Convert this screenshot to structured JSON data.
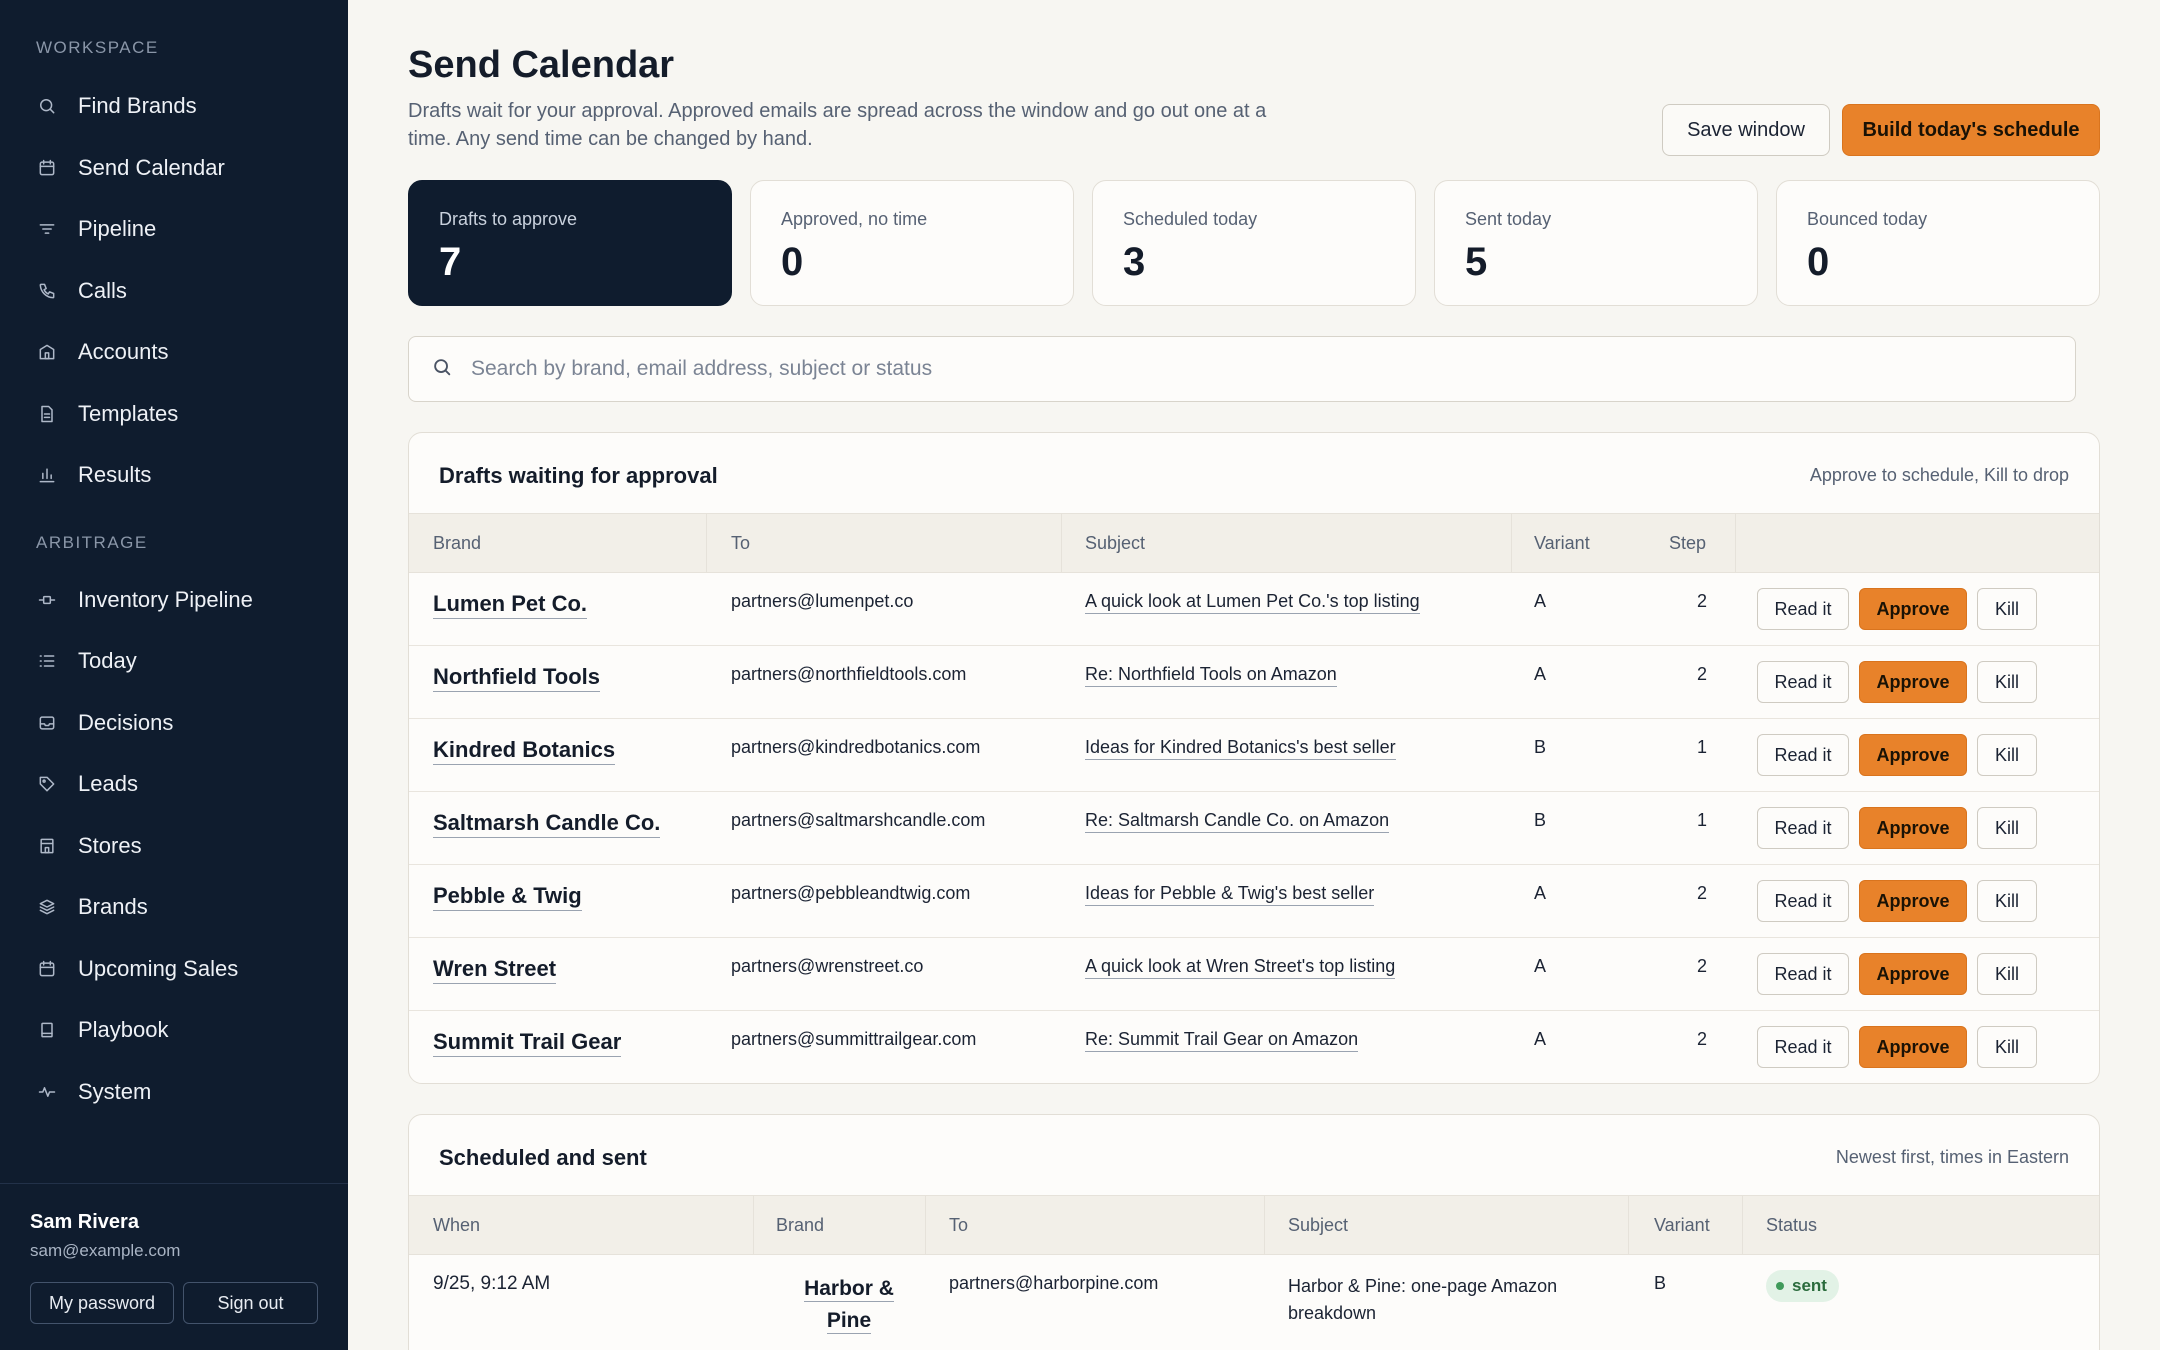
{
  "sidebar": {
    "workspace_label": "WORKSPACE",
    "workspace_items": [
      {
        "label": "Find Brands",
        "icon": "search-icon"
      },
      {
        "label": "Send Calendar",
        "icon": "calendar-icon"
      },
      {
        "label": "Pipeline",
        "icon": "filter-icon"
      },
      {
        "label": "Calls",
        "icon": "phone-icon"
      },
      {
        "label": "Accounts",
        "icon": "building-icon"
      },
      {
        "label": "Templates",
        "icon": "document-icon"
      },
      {
        "label": "Results",
        "icon": "bar-chart-icon"
      }
    ],
    "arbitrage_label": "ARBITRAGE",
    "arbitrage_items": [
      {
        "label": "Inventory Pipeline",
        "icon": "pipeline-icon"
      },
      {
        "label": "Today",
        "icon": "list-icon"
      },
      {
        "label": "Decisions",
        "icon": "inbox-icon"
      },
      {
        "label": "Leads",
        "icon": "tag-icon"
      },
      {
        "label": "Stores",
        "icon": "store-icon"
      },
      {
        "label": "Brands",
        "icon": "layers-icon"
      },
      {
        "label": "Upcoming Sales",
        "icon": "calendar-icon"
      },
      {
        "label": "Playbook",
        "icon": "book-icon"
      },
      {
        "label": "System",
        "icon": "activity-icon"
      }
    ],
    "user": {
      "name": "Sam Rivera",
      "email": "sam@example.com"
    },
    "my_password_label": "My password",
    "sign_out_label": "Sign out"
  },
  "header": {
    "title": "Send Calendar",
    "description": "Drafts wait for your approval. Approved emails are spread across the window and go out one at a time. Any send time can be changed by hand.",
    "save_window_label": "Save window",
    "build_schedule_label": "Build today's schedule"
  },
  "stats": [
    {
      "label": "Drafts to approve",
      "value": "7"
    },
    {
      "label": "Approved, no time",
      "value": "0"
    },
    {
      "label": "Scheduled today",
      "value": "3"
    },
    {
      "label": "Sent today",
      "value": "5"
    },
    {
      "label": "Bounced today",
      "value": "0"
    }
  ],
  "search": {
    "placeholder": "Search by brand, email address, subject or status"
  },
  "drafts": {
    "title": "Drafts waiting for approval",
    "note": "Approve to schedule, Kill to drop",
    "columns": {
      "brand": "Brand",
      "to": "To",
      "subject": "Subject",
      "variant": "Variant",
      "step": "Step"
    },
    "read_label": "Read it",
    "approve_label": "Approve",
    "kill_label": "Kill",
    "rows": [
      {
        "brand": "Lumen Pet Co.",
        "to": "partners@lumenpet.co",
        "subject": "A quick look at Lumen Pet Co.'s top listing",
        "variant": "A",
        "step": "2"
      },
      {
        "brand": "Northfield Tools",
        "to": "partners@northfieldtools.com",
        "subject": "Re: Northfield Tools on Amazon",
        "variant": "A",
        "step": "2"
      },
      {
        "brand": "Kindred Botanics",
        "to": "partners@kindredbotanics.com",
        "subject": "Ideas for Kindred Botanics's best seller",
        "variant": "B",
        "step": "1"
      },
      {
        "brand": "Saltmarsh Candle Co.",
        "to": "partners@saltmarshcandle.com",
        "subject": "Re: Saltmarsh Candle Co. on Amazon",
        "variant": "B",
        "step": "1"
      },
      {
        "brand": "Pebble & Twig",
        "to": "partners@pebbleandtwig.com",
        "subject": "Ideas for Pebble & Twig's best seller",
        "variant": "A",
        "step": "2"
      },
      {
        "brand": "Wren Street",
        "to": "partners@wrenstreet.co",
        "subject": "A quick look at Wren Street's top listing",
        "variant": "A",
        "step": "2"
      },
      {
        "brand": "Summit Trail Gear",
        "to": "partners@summittrailgear.com",
        "subject": "Re: Summit Trail Gear on Amazon",
        "variant": "A",
        "step": "2"
      }
    ]
  },
  "scheduled": {
    "title": "Scheduled and sent",
    "note": "Newest first, times in Eastern",
    "columns": {
      "when": "When",
      "brand": "Brand",
      "to": "To",
      "subject": "Subject",
      "variant": "Variant",
      "status": "Status"
    },
    "rows": [
      {
        "when": "9/25, 9:12 AM",
        "brand": "Harbor & Pine",
        "to": "partners@harborpine.com",
        "subject": "Harbor & Pine: one-page Amazon breakdown",
        "variant": "B",
        "status": "sent"
      }
    ]
  }
}
